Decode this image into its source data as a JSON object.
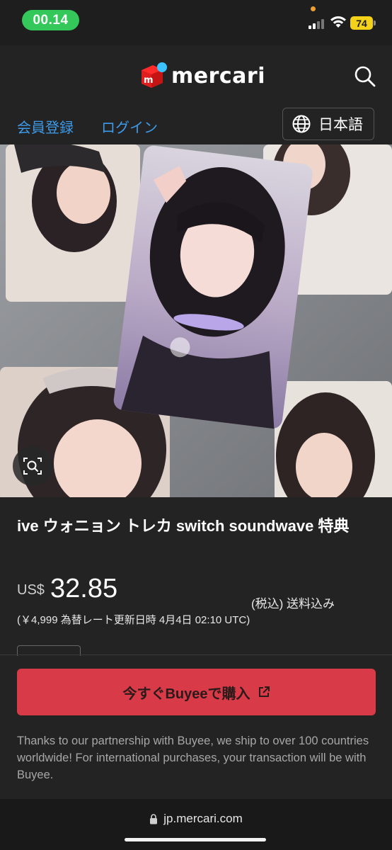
{
  "status_bar": {
    "time": "00.14",
    "battery_level": "74",
    "colors": {
      "time_pill": "#34c759",
      "battery": "#f4d21a"
    },
    "icons": [
      "signal-icon",
      "wifi-icon",
      "battery-icon"
    ]
  },
  "header": {
    "logo_text": "mercari",
    "icons": [
      "mercari-logo-icon",
      "search-icon"
    ]
  },
  "nav": {
    "register_label": "会員登録",
    "login_label": "ログイン",
    "language_label": "日本語",
    "link_color": "#3d9be9",
    "icons": [
      "globe-icon"
    ]
  },
  "product": {
    "image_icons": [
      "lens-search-icon"
    ],
    "title": "ive ウォニョン トレカ switch soundwave 特典",
    "currency": "US$",
    "price": "32.85",
    "tax_shipping": "(税込) 送料込み",
    "exchange_note": "(￥4,999 為替レート更新日時 4月4日 02:10 UTC)"
  },
  "buy": {
    "button_label": "今すぐBuyeeで購入",
    "button_color": "#d83a48",
    "icons": [
      "external-link-icon"
    ],
    "note": "Thanks to our partnership with Buyee, we ship to over 100 countries worldwide! For international purchases, your transaction will be with Buyee."
  },
  "browser": {
    "url": "jp.mercari.com",
    "icons": [
      "lock-icon"
    ]
  }
}
